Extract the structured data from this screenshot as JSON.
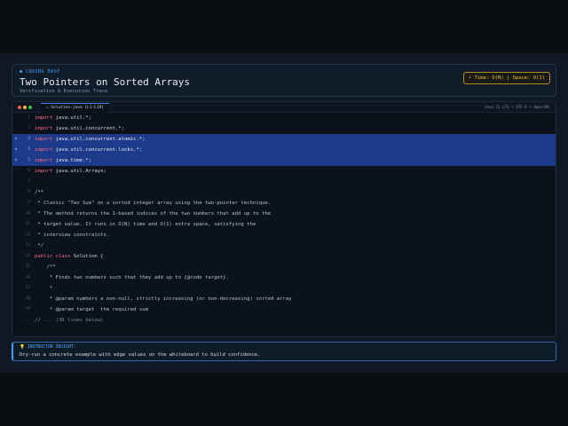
{
  "header": {
    "badge": "● CODING EASY",
    "title": "Two Pointers on Sorted Arrays",
    "subtitle": "Verification & Execution Trace",
    "complexity": "⚡ Time: O(N)  |  Space: O(1)"
  },
  "editor": {
    "tab": "☕ Solution.java [L1-L19]",
    "env": "Java 21 LTS • UTF-8 • OpenJDK",
    "highlight_color": "#1e3a8a",
    "lines": [
      {
        "n": "1",
        "kw": "import",
        "rest": " java.util.*;",
        "hl": false
      },
      {
        "n": "2",
        "kw": "import",
        "rest": " java.util.concurrent.*;",
        "hl": false
      },
      {
        "n": "3",
        "kw": "import",
        "rest": " java.util.concurrent.atomic.*;",
        "hl": true
      },
      {
        "n": "4",
        "kw": "import",
        "rest": " java.util.concurrent.locks.*;",
        "hl": true
      },
      {
        "n": "5",
        "kw": "import",
        "rest": " java.time.*;",
        "hl": true
      },
      {
        "n": "6",
        "kw": "import",
        "rest": " java.util.Arrays;",
        "hl": false
      },
      {
        "n": "7",
        "kw": "",
        "rest": "",
        "hl": false
      },
      {
        "n": "8",
        "kw": "",
        "rest": "/**",
        "hl": false
      },
      {
        "n": "9",
        "kw": "",
        "rest": " * Classic \"Two Sum\" on a sorted integer array using the two-pointer technique.",
        "hl": false
      },
      {
        "n": "10",
        "kw": "",
        "rest": " * The method returns the 1-based indices of the two numbers that add up to the",
        "hl": false
      },
      {
        "n": "11",
        "kw": "",
        "rest": " * target value. It runs in O(N) time and O(1) extra space, satisfying the",
        "hl": false
      },
      {
        "n": "12",
        "kw": "",
        "rest": " * interview constraints.",
        "hl": false
      },
      {
        "n": "13",
        "kw": "",
        "rest": " */",
        "hl": false
      },
      {
        "n": "14",
        "kw": "public class",
        "rest": " Solution {",
        "hl": false
      },
      {
        "n": "15",
        "kw": "",
        "rest": "    /**",
        "hl": false
      },
      {
        "n": "16",
        "kw": "",
        "rest": "     * Finds two numbers such that they add up to {@code target}.",
        "hl": false
      },
      {
        "n": "17",
        "kw": "",
        "rest": "     *",
        "hl": false
      },
      {
        "n": "18",
        "kw": "",
        "rest": "     * @param numbers a non-null, strictly increasing (or non-decreasing) sorted array",
        "hl": false
      },
      {
        "n": "19",
        "kw": "",
        "rest": "     * @param target  the required sum",
        "hl": false
      },
      {
        "n": "...",
        "kw": "",
        "rest": "// ... (36 lines below)",
        "hl": false
      }
    ]
  },
  "insight": {
    "label": "💡 INSTRUCTOR INSIGHT:",
    "text": "Dry-run a concrete example with edge values on the whiteboard to build confidence."
  }
}
